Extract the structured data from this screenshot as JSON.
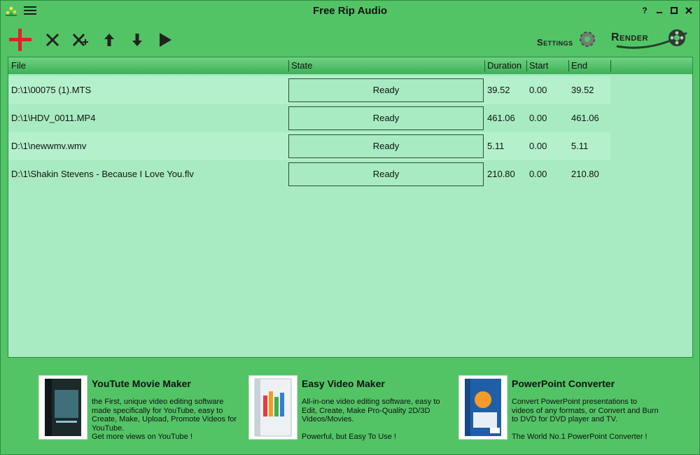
{
  "window": {
    "title": "Free Rip Audio",
    "help_label": "?",
    "app_icon": "app-logo-icon",
    "menu_icon": "hamburger-menu-icon"
  },
  "toolbar": {
    "add_icon": "plus-icon",
    "remove_icon": "close-icon",
    "clear_icon": "clear-all-icon",
    "up_icon": "arrow-up-icon",
    "down_icon": "arrow-down-icon",
    "play_icon": "play-icon",
    "settings_label": "Settings",
    "render_label": "Render"
  },
  "table": {
    "columns": [
      "File",
      "State",
      "Duration",
      "Start",
      "End"
    ],
    "rows": [
      {
        "file": "D:\\1\\00075 (1).MTS",
        "state": "Ready",
        "duration": "39.52",
        "start": "0.00",
        "end": "39.52"
      },
      {
        "file": "D:\\1\\HDV_0011.MP4",
        "state": "Ready",
        "duration": "461.06",
        "start": "0.00",
        "end": "461.06"
      },
      {
        "file": "D:\\1\\newwmv.wmv",
        "state": "Ready",
        "duration": "5.11",
        "start": "0.00",
        "end": "5.11"
      },
      {
        "file": "D:\\1\\Shakin Stevens - Because I Love You.flv",
        "state": "Ready",
        "duration": "210.80",
        "start": "0.00",
        "end": "210.80"
      }
    ]
  },
  "ads": [
    {
      "title": "YouTute Movie Maker",
      "desc": "the First, unique video editing software made specifically for YouTube, easy to Create, Make, Upload, Promote Videos for YouTube.\nGet more views on YouTube !"
    },
    {
      "title": "Easy Video Maker",
      "desc": "All-in-one video editing software, easy to Edit, Create, Make Pro-Quality 2D/3D Videos/Movies.\n\nPowerful, but Easy To Use !"
    },
    {
      "title": "PowerPoint Converter",
      "desc": "Convert PowerPoint presentations to videos of any formats, or Convert and Burn to DVD for DVD player and TV.\n\nThe World No.1 PowerPoint Converter !"
    }
  ],
  "colors": {
    "window_bg": "#53c466",
    "list_bg": "#a8ebc2",
    "row_alt": "#b4f0cc",
    "header_top": "#6fd384",
    "add_red": "#e0202a"
  }
}
